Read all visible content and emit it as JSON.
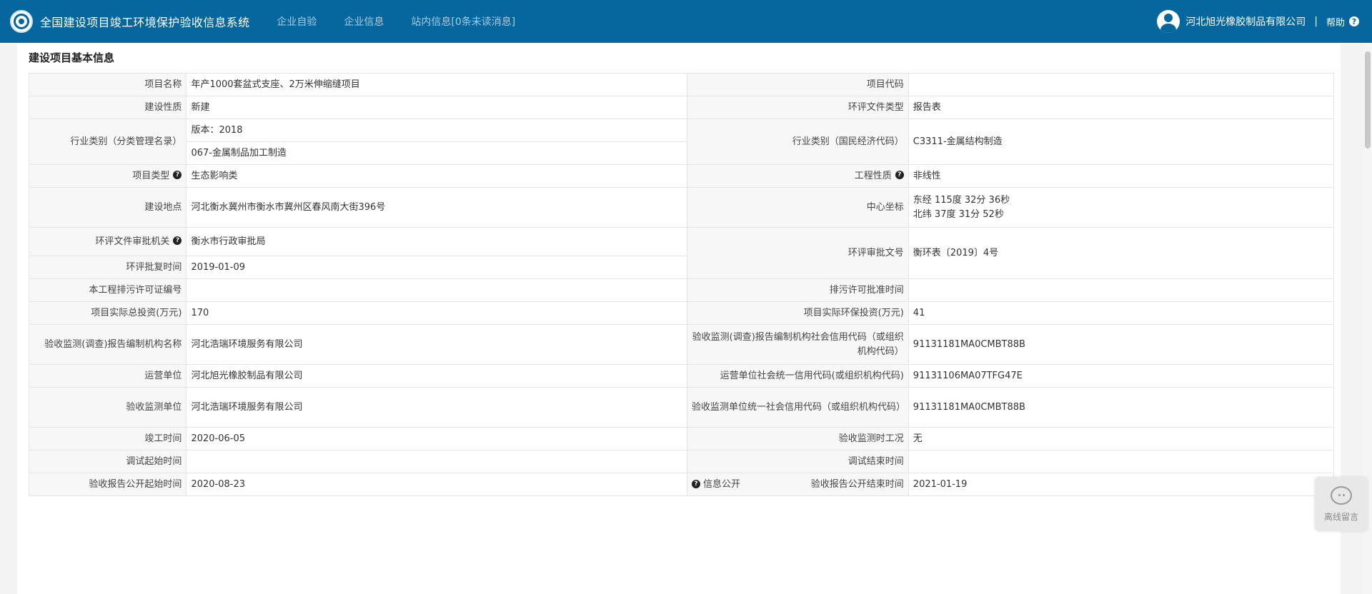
{
  "header": {
    "title": "全国建设项目竣工环境保护验收信息系统",
    "nav": [
      "企业自验",
      "企业信息",
      "站内信息[0条未读消息]"
    ],
    "company": "河北旭光橡胶制品有限公司",
    "separator": "|",
    "help": "帮助",
    "help_icon": "?"
  },
  "section_title": "建设项目基本信息",
  "fields": {
    "project_name_label": "项目名称",
    "project_name": "年产1000套盆式支座、2万米伸缩缝项目",
    "project_code_label": "项目代码",
    "project_code": "",
    "build_nature_label": "建设性质",
    "build_nature": "新建",
    "eia_doc_type_label": "环评文件类型",
    "eia_doc_type": "报告表",
    "industry_cat_label": "行业类别（分类管理名录）",
    "industry_version": "版本：2018",
    "industry_cat": "067-金属制品加工制造",
    "industry_econ_label": "行业类别（国民经济代码）",
    "industry_econ": "C3311-金属结构制造",
    "project_type_label": "项目类型",
    "project_type": "生态影响类",
    "eng_nature_label": "工程性质",
    "eng_nature": "非线性",
    "location_label": "建设地点",
    "location": "河北衡水冀州市衡水市冀州区春风南大街396号",
    "center_coord_label": "中心坐标",
    "center_lon": "东经 115度 32分 36秒",
    "center_lat": "北纬 37度 31分 52秒",
    "eia_authority_label": "环评文件审批机关",
    "eia_authority": "衡水市行政审批局",
    "eia_approval_no_label": "环评审批文号",
    "eia_approval_no": "衡环表〔2019〕4号",
    "eia_approval_date_label": "环评批复时间",
    "eia_approval_date": "2019-01-09",
    "permit_no_label": "本工程排污许可证编号",
    "permit_no": "",
    "permit_date_label": "排污许可批准时间",
    "permit_date": "",
    "total_invest_label": "项目实际总投资(万元)",
    "total_invest": "170",
    "env_invest_label": "项目实际环保投资(万元)",
    "env_invest": "41",
    "report_org_label": "验收监测(调查)报告编制机构名称",
    "report_org": "河北浩瑞环境服务有限公司",
    "report_org_code_label": "验收监测(调查)报告编制机构社会信用代码（或组织机构代码）",
    "report_org_code": "91131181MA0CMBT88B",
    "operator_label": "运营单位",
    "operator": "河北旭光橡胶制品有限公司",
    "operator_code_label": "运营单位社会统一信用代码(或组织机构代码)",
    "operator_code": "91131106MA07TFG47E",
    "monitor_org_label": "验收监测单位",
    "monitor_org": "河北浩瑞环境服务有限公司",
    "monitor_org_code_label": "验收监测单位统一社会信用代码（或组织机构代码）",
    "monitor_org_code": "91131181MA0CMBT88B",
    "completion_date_label": "竣工时间",
    "completion_date": "2020-06-05",
    "monitor_condition_label": "验收监测时工况",
    "monitor_condition": "无",
    "debug_start_label": "调试起始时间",
    "debug_start": "",
    "debug_end_label": "调试结束时间",
    "debug_end": "",
    "pub_start_label": "验收报告公开起始时间",
    "pub_start": "2020-08-23",
    "info_public_label": "信息公开",
    "pub_end_label": "验收报告公开结束时间",
    "pub_end": "2021-01-19"
  },
  "chat_widget": {
    "label": "离线留言"
  },
  "icons": {
    "help_question": "question-circle-icon",
    "chat": "chat-bubble-icon",
    "avatar": "user-avatar-icon"
  },
  "colors": {
    "header_bg": "#05679d",
    "label_bg": "#f7f7f7",
    "border": "#e4e4e4"
  }
}
